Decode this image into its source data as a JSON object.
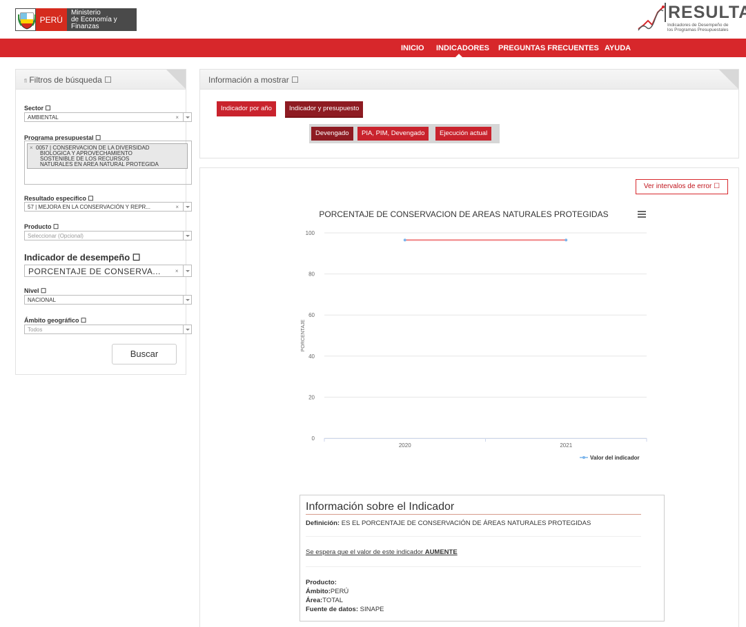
{
  "header": {
    "peru": "PERÚ",
    "ministerio_1": "Ministerio",
    "ministerio_2": "de Economía y Finanzas",
    "resulta": "RESULTA",
    "resulta_sub_1": "Indicadores de Desempeño de",
    "resulta_sub_2": "los Programas Presupuestales"
  },
  "nav": {
    "items": [
      "INICIO",
      "INDICADORES",
      "PREGUNTAS FRECUENTES",
      "AYUDA"
    ]
  },
  "filters": {
    "title": "Filtros de búsqueda",
    "sector_label": "Sector",
    "sector_value": "AMBIENTAL",
    "programa_label": "Programa presupuestal",
    "programa_lines": [
      "0057 | CONSERVACION DE LA DIVERSIDAD",
      "BIOLOGICA Y APROVECHAMIENTO",
      "SOSTENIBLE DE LOS RECURSOS",
      "NATURALES EN AREA NATURAL PROTEGIDA"
    ],
    "resultado_label": "Resultado específico",
    "resultado_value": "57 | MEJORA EN LA CONSERVACIÓN Y REPR...",
    "producto_label": "Producto",
    "producto_placeholder": "Seleccionar (Opcional)",
    "indicador_label": "Indicador de desempeño",
    "indicador_value": "PORCENTAJE DE CONSERVA...",
    "nivel_label": "Nivel",
    "nivel_value": "NACIONAL",
    "ambito_label": "Ámbito geográfico",
    "ambito_value": "Todos",
    "buscar": "Buscar",
    "clear_glyph": "×",
    "info_glyph": "☐"
  },
  "info_panel": {
    "title": "Información a mostrar",
    "tab_1": "Indicador por año",
    "tab_2": "Indicador y presupuesto",
    "sub_1": "Devengado",
    "sub_2": "PIA, PIM, Devengado",
    "sub_3": "Ejecución actual"
  },
  "chart_panel": {
    "error_button": "Ver intervalos de error"
  },
  "chart_data": {
    "type": "line",
    "title": "PORCENTAJE DE CONSERVACION DE AREAS NATURALES PROTEGIDAS",
    "ylabel": "PORCENTAJE",
    "xlabel": "",
    "categories": [
      "2020",
      "2021"
    ],
    "yticks": [
      0,
      20,
      40,
      60,
      80,
      100
    ],
    "ylim": [
      0,
      100
    ],
    "series": [
      {
        "name": "Valor del indicador",
        "values": [
          96.5,
          96.5
        ],
        "line_color": "#f07f80",
        "marker_color": "#7cb5ec"
      }
    ],
    "grid": true,
    "legend": "bottom-right"
  },
  "indicator_info": {
    "title": "Información sobre el Indicador",
    "definicion_label": "Definición:",
    "definicion_value": "ES EL PORCENTAJE DE CONSERVACIÓN DE ÁREAS NATURALES PROTEGIDAS",
    "expect_text": "Se espera que el valor de este indicador",
    "expect_value": "AUMENTE",
    "producto_label": "Producto:",
    "ambito_label": "Ámbito:",
    "ambito_value": "PERÚ",
    "area_label": "Área:",
    "area_value": "TOTAL",
    "fuente_label": "Fuente de datos:",
    "fuente_value": "SINAPE"
  }
}
